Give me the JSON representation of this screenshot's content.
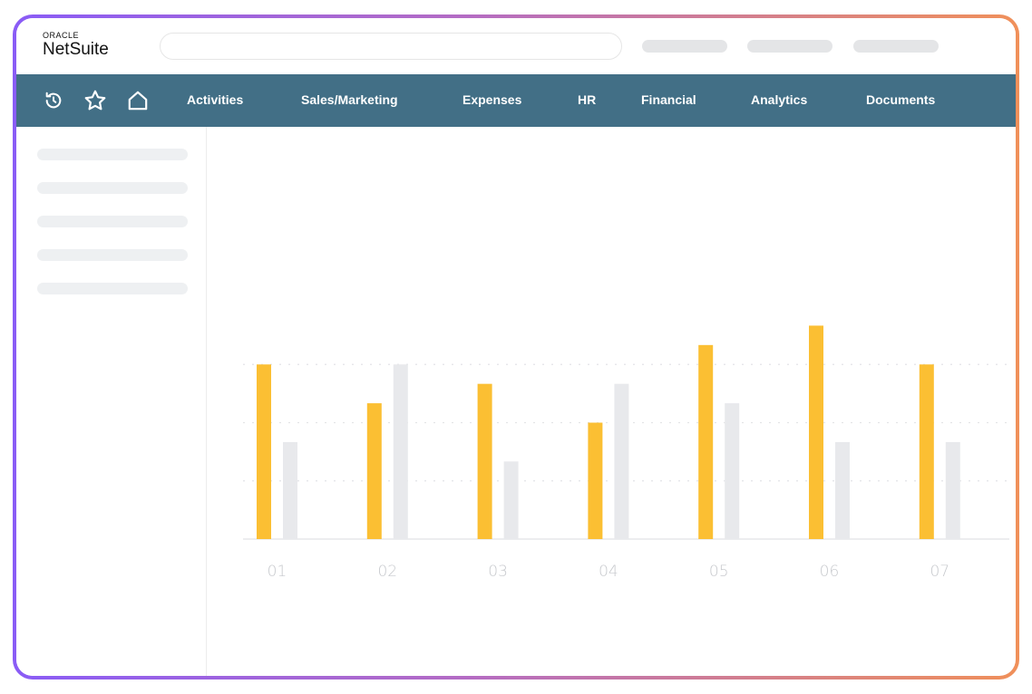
{
  "app": {
    "brand_top": "ORACLE",
    "brand_name": "NetSuite"
  },
  "icons": {
    "recent": "history-icon",
    "favorites": "star-icon",
    "home": "home-icon"
  },
  "nav": {
    "items": [
      {
        "label": "Activities"
      },
      {
        "label": "Sales/Marketing"
      },
      {
        "label": "Expenses"
      },
      {
        "label": "HR"
      },
      {
        "label": "Financial"
      },
      {
        "label": "Analytics"
      },
      {
        "label": "Documents"
      }
    ]
  },
  "colors": {
    "navbar": "#426f86",
    "series_primary": "#fbbf33",
    "series_secondary": "#e8e9ec",
    "frame_gradient_start": "#8a5cf6",
    "frame_gradient_end": "#f0905a"
  },
  "chart_data": {
    "type": "bar",
    "categories": [
      "01",
      "02",
      "03",
      "04",
      "05",
      "06",
      "07"
    ],
    "series": [
      {
        "color": "#fbbf33",
        "values": [
          90,
          70,
          80,
          60,
          100,
          110,
          90
        ]
      },
      {
        "color": "#e8e9ec",
        "values": [
          50,
          90,
          40,
          80,
          70,
          50,
          50
        ]
      }
    ],
    "ylim": [
      0,
      120
    ],
    "grid": true,
    "title": "",
    "xlabel": "",
    "ylabel": ""
  }
}
